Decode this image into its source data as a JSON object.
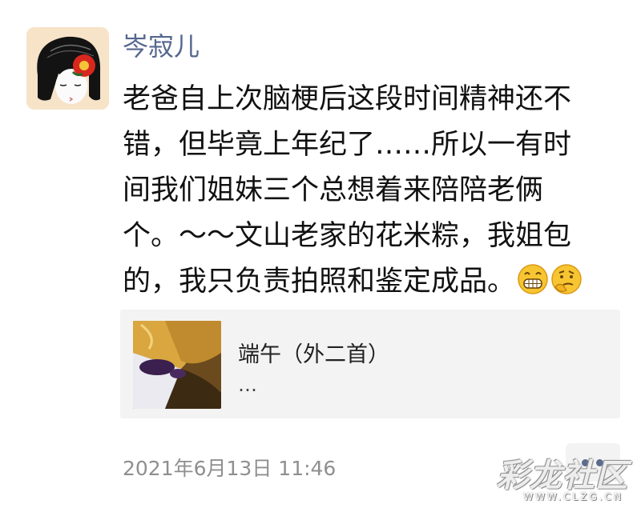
{
  "post": {
    "author": "岑寂儿",
    "lines": [
      "老爸自上次脑梗后这段时间精神还不",
      "错，但毕竟上年纪了……所以一有时",
      "间我们姐妹三个总想着来陪陪老俩",
      "个。～～文山老家的花米粽，我姐包",
      "的，我只负责拍照和鉴定成品。"
    ],
    "emojis": [
      "grinning-face-emoji",
      "thinking-face-emoji"
    ],
    "timestamp": "2021年6月13日 11:46"
  },
  "link_card": {
    "title": "端午（外二首）",
    "subtitle": "…"
  },
  "watermark": {
    "text": "彩龙社区",
    "url": "WWW.CLZG.CN"
  },
  "colors": {
    "author": "#55678f",
    "card_bg": "#f3f3f3",
    "timestamp": "#8f8f8f"
  }
}
